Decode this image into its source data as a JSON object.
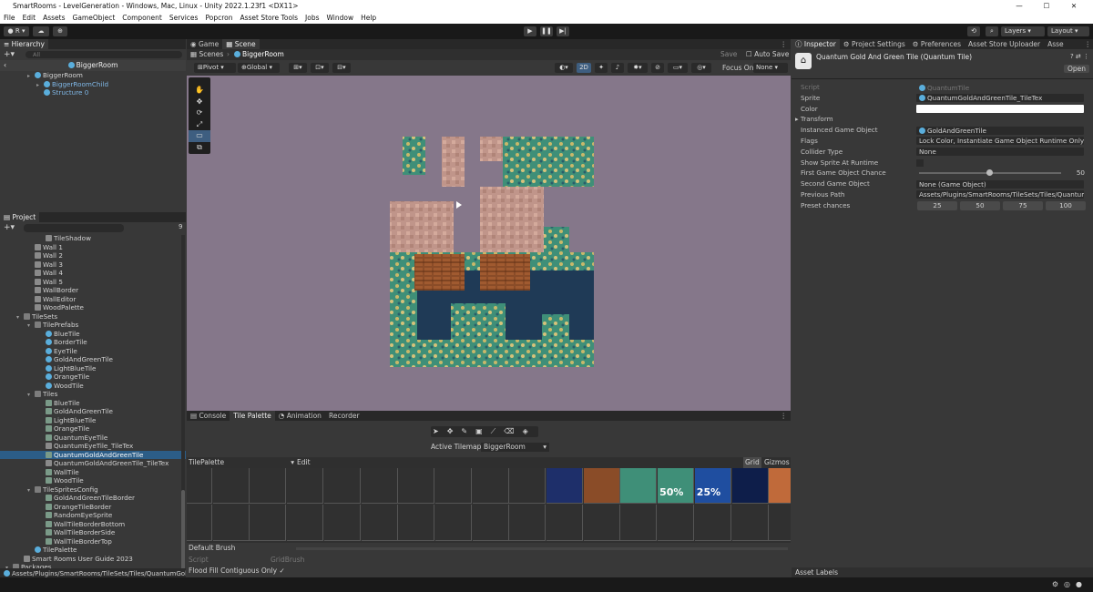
{
  "window": {
    "title": "SmartRooms - LevelGeneration - Windows, Mac, Linux - Unity 2022.1.23f1 <DX11>"
  },
  "menu": [
    "File",
    "Edit",
    "Assets",
    "GameObject",
    "Component",
    "Services",
    "Popcron",
    "Asset Store Tools",
    "Jobs",
    "Window",
    "Help"
  ],
  "toolbar": {
    "account": "R",
    "layers": "Layers",
    "layout": "Layout"
  },
  "hierarchy": {
    "tab": "Hierarchy",
    "search_placeholder": "All",
    "scene_name": "BiggerRoom",
    "items": [
      {
        "label": "BiggerRoom",
        "depth": 0,
        "kind": "prefab"
      },
      {
        "label": "BiggerRoomChild",
        "depth": 1,
        "kind": "prefab"
      },
      {
        "label": "Structure 0",
        "depth": 1,
        "kind": "prefab"
      }
    ]
  },
  "project": {
    "tab": "Project",
    "badge": "9",
    "items": [
      {
        "label": "TileShadow",
        "depth": 3,
        "kind": "tex"
      },
      {
        "label": "Wall 1",
        "depth": 2,
        "kind": "tex"
      },
      {
        "label": "Wall 2",
        "depth": 2,
        "kind": "tex"
      },
      {
        "label": "Wall 3",
        "depth": 2,
        "kind": "tex"
      },
      {
        "label": "Wall 4",
        "depth": 2,
        "kind": "tex"
      },
      {
        "label": "Wall 5",
        "depth": 2,
        "kind": "tex"
      },
      {
        "label": "WallBorder",
        "depth": 2,
        "kind": "tex"
      },
      {
        "label": "WallEditor",
        "depth": 2,
        "kind": "tex"
      },
      {
        "label": "WoodPalette",
        "depth": 2,
        "kind": "tex"
      },
      {
        "label": "TileSets",
        "depth": 1,
        "kind": "folder"
      },
      {
        "label": "TilePrefabs",
        "depth": 2,
        "kind": "folder"
      },
      {
        "label": "BlueTile",
        "depth": 3,
        "kind": "prefab"
      },
      {
        "label": "BorderTile",
        "depth": 3,
        "kind": "prefab"
      },
      {
        "label": "EyeTile",
        "depth": 3,
        "kind": "prefab"
      },
      {
        "label": "GoldAndGreenTile",
        "depth": 3,
        "kind": "prefab"
      },
      {
        "label": "LightBlueTile",
        "depth": 3,
        "kind": "prefab"
      },
      {
        "label": "OrangeTile",
        "depth": 3,
        "kind": "prefab"
      },
      {
        "label": "WoodTile",
        "depth": 3,
        "kind": "prefab"
      },
      {
        "label": "Tiles",
        "depth": 2,
        "kind": "folder"
      },
      {
        "label": "BlueTile",
        "depth": 3,
        "kind": "tile"
      },
      {
        "label": "GoldAndGreenTile",
        "depth": 3,
        "kind": "tile"
      },
      {
        "label": "LightBlueTile",
        "depth": 3,
        "kind": "tile"
      },
      {
        "label": "OrangeTile",
        "depth": 3,
        "kind": "tile"
      },
      {
        "label": "QuantumEyeTile",
        "depth": 3,
        "kind": "tile"
      },
      {
        "label": "QuantumEyeTile_TileTex",
        "depth": 3,
        "kind": "tex"
      },
      {
        "label": "QuantumGoldAndGreenTile",
        "depth": 3,
        "kind": "tile",
        "selected": true
      },
      {
        "label": "QuantumGoldAndGreenTile_TileTex",
        "depth": 3,
        "kind": "tex"
      },
      {
        "label": "WallTile",
        "depth": 3,
        "kind": "tile"
      },
      {
        "label": "WoodTile",
        "depth": 3,
        "kind": "tile"
      },
      {
        "label": "TileSpritesConfig",
        "depth": 2,
        "kind": "folder"
      },
      {
        "label": "GoldAndGreenTileBorder",
        "depth": 3,
        "kind": "tile"
      },
      {
        "label": "OrangeTileBorder",
        "depth": 3,
        "kind": "tile"
      },
      {
        "label": "RandomEyeSprite",
        "depth": 3,
        "kind": "tile"
      },
      {
        "label": "WallTileBorderBottom",
        "depth": 3,
        "kind": "tile"
      },
      {
        "label": "WallTileBorderSide",
        "depth": 3,
        "kind": "tile"
      },
      {
        "label": "WallTileBorderTop",
        "depth": 3,
        "kind": "tile"
      },
      {
        "label": "TilePalette",
        "depth": 2,
        "kind": "prefab"
      },
      {
        "label": "Smart Rooms User Guide 2023",
        "depth": 1,
        "kind": "tex"
      },
      {
        "label": "Packages",
        "depth": 0,
        "kind": "folder"
      }
    ],
    "path": "Assets/Plugins/SmartRooms/TileSets/Tiles/QuantumGolc"
  },
  "scene": {
    "tabs": [
      "Game",
      "Scene"
    ],
    "breadcrumb": [
      "Scenes",
      "BiggerRoom"
    ],
    "save": "Save",
    "auto_save": "Auto Save",
    "pivot": "Pivot",
    "global": "Global",
    "mode_2d": "2D",
    "focus_on": "Focus On",
    "focus_value": "None"
  },
  "bottom": {
    "tabs": [
      "Console",
      "Tile Palette",
      "Animation",
      "Recorder"
    ],
    "active_tilemap_label": "Active Tilemap",
    "active_tilemap": "BiggerRoom",
    "palette_name": "TilePalette",
    "edit": "Edit",
    "grid": "Grid",
    "gizmos": "Gizmos",
    "palette_badges": [
      "50%",
      "25%"
    ],
    "brush": "Default Brush",
    "script_label": "Script",
    "script_value": "GridBrush",
    "flood_fill": "Flood Fill Contiguous Only"
  },
  "inspector": {
    "tabs": [
      "Inspector",
      "Project Settings",
      "Preferences",
      "Asset Store Uploader",
      "Asse"
    ],
    "title": "Quantum Gold And Green Tile (Quantum Tile)",
    "open": "Open",
    "fields": [
      {
        "label": "Script",
        "value": "QuantumTile",
        "dim": true
      },
      {
        "label": "Sprite",
        "value": "QuantumGoldAndGreenTile_TileTex"
      },
      {
        "label": "Color",
        "value": ""
      },
      {
        "label": "Transform",
        "value": null
      },
      {
        "label": "Instanced Game Object",
        "value": "GoldAndGreenTile"
      },
      {
        "label": "Flags",
        "value": "Lock Color, Instantiate Game Object Runtime Only"
      },
      {
        "label": "Collider Type",
        "value": "None"
      },
      {
        "label": "Show Sprite At Runtime",
        "value": null
      },
      {
        "label": "First Game Object Chance",
        "value": null
      },
      {
        "label": "Second Game Object",
        "value": "None (Game Object)"
      },
      {
        "label": "Previous Path",
        "value": "Assets/Plugins/SmartRooms/TileSets/Tiles/QuantumGol"
      },
      {
        "label": "Preset chances",
        "value": null
      }
    ],
    "chance_value": "50",
    "chance_fraction": 0.5,
    "presets": [
      "25",
      "50",
      "75",
      "100"
    ],
    "asset_labels": "Asset Labels"
  }
}
